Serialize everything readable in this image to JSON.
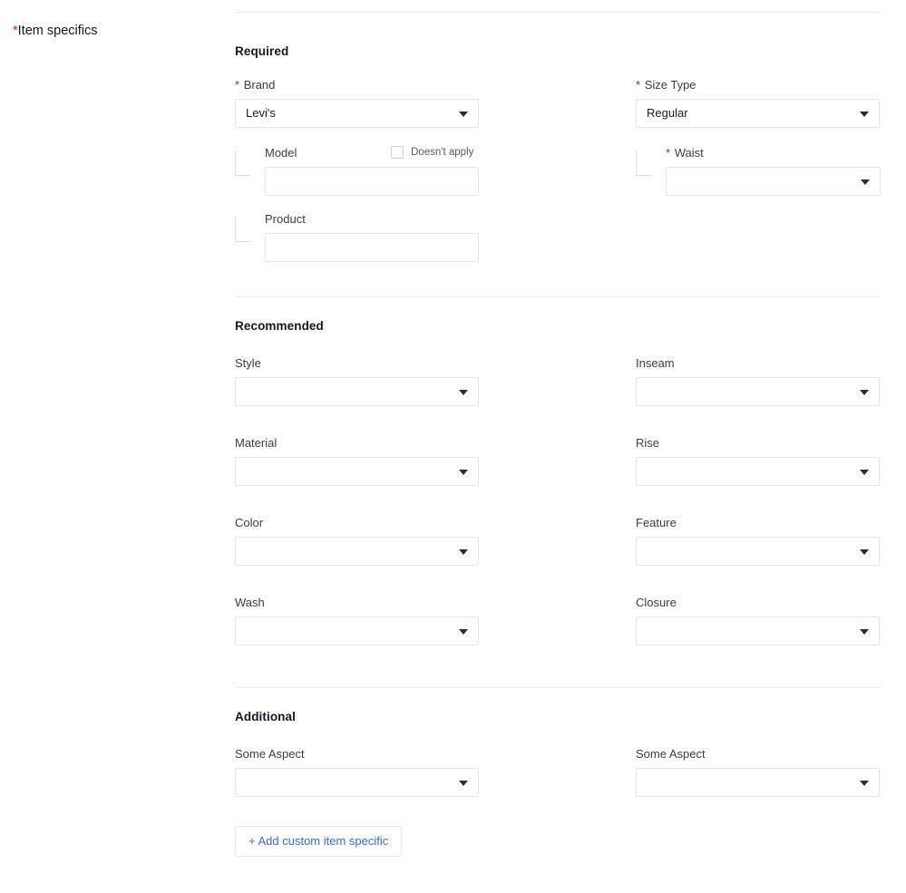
{
  "page": {
    "required_marker": "*",
    "title": "Item specifics",
    "accent_blue": "#3665f3",
    "required_red": "#e0103a"
  },
  "sections": [
    {
      "id": "required",
      "title": "Required",
      "fields": {
        "brand": {
          "label": "Brand",
          "required_star": "*",
          "value": "Levi's",
          "type": "select"
        },
        "size_type": {
          "label": "Size Type",
          "required_star": "*",
          "value": "Regular",
          "type": "select"
        },
        "model": {
          "label": "Model",
          "value": "",
          "placeholder": "",
          "type": "text",
          "nested": true
        },
        "waist": {
          "label": "Waist",
          "required_star": "*",
          "value": "",
          "type": "select",
          "nested": true
        },
        "product": {
          "label": "Product",
          "value": "",
          "placeholder": "",
          "type": "text",
          "nested": true
        }
      },
      "doesnt_apply": {
        "label": "Doesn't apply",
        "checked": false
      }
    },
    {
      "id": "recommended",
      "title": "Recommended",
      "fields": {
        "style": {
          "label": "Style",
          "value": "",
          "type": "select"
        },
        "inseam": {
          "label": "Inseam",
          "value": "",
          "type": "select"
        },
        "material": {
          "label": "Material",
          "value": "",
          "type": "select"
        },
        "rise": {
          "label": "Rise",
          "value": "",
          "type": "select"
        },
        "color": {
          "label": "Color",
          "value": "",
          "type": "select"
        },
        "feature": {
          "label": "Feature",
          "value": "",
          "type": "select"
        },
        "wash": {
          "label": "Wash",
          "value": "",
          "type": "select"
        },
        "closure": {
          "label": "Closure",
          "value": "",
          "type": "select"
        }
      }
    },
    {
      "id": "additional",
      "title": "Additional",
      "fields": {
        "aspect_left": {
          "label": "Some Aspect",
          "value": "",
          "type": "select"
        },
        "aspect_right": {
          "label": "Some Aspect",
          "value": "",
          "type": "select"
        }
      },
      "add_button": {
        "label": "+ Add custom item specific"
      }
    }
  ]
}
